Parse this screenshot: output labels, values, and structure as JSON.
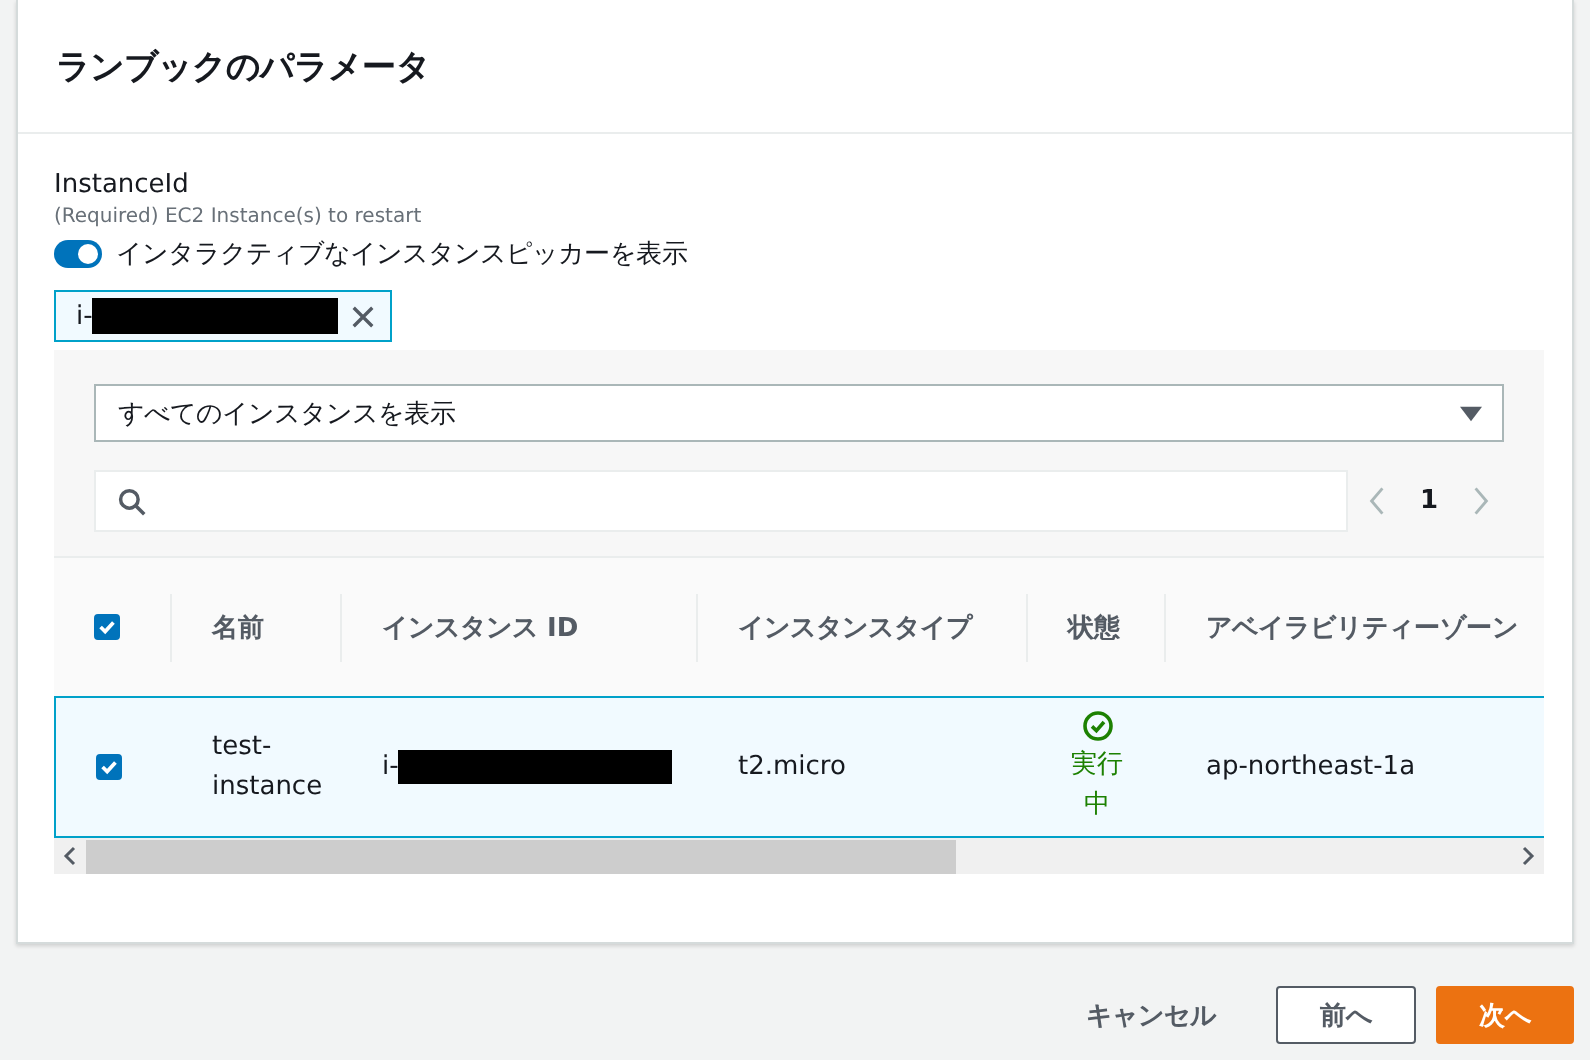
{
  "title": "ランブックのパラメータ",
  "parameter": {
    "label": "InstanceId",
    "description": "(Required) EC2 Instance(s) to restart"
  },
  "toggle": {
    "label": "インタラクティブなインスタンスピッカーを表示",
    "on": true
  },
  "token": {
    "prefix": "i-",
    "redacted": true
  },
  "filter": {
    "value": "すべてのインスタンスを表示"
  },
  "pagination": {
    "page": "1"
  },
  "table": {
    "all_checked": true,
    "columns": [
      "名前",
      "インスタンス ID",
      "インスタンスタイプ",
      "状態",
      "アベイラビリティーゾーン"
    ],
    "rows": [
      {
        "selected": true,
        "name": "test-instance",
        "id_prefix": "i-",
        "id_redacted": true,
        "type": "t2.micro",
        "state": {
          "kind": "running",
          "label": "実行中"
        },
        "zone": "ap-northeast-1a"
      }
    ]
  },
  "buttons": {
    "cancel": "キャンセル",
    "previous": "前へ",
    "next": "次へ"
  }
}
